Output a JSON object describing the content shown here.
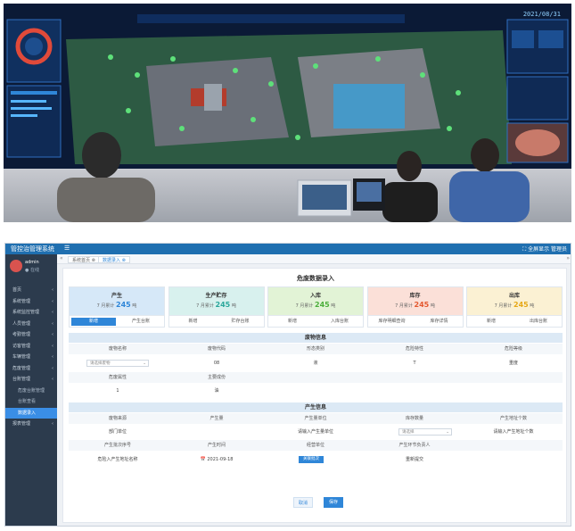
{
  "photo": {
    "wall_title": "",
    "wall_time": "2021/08/31",
    "accent": "#0b1a36"
  },
  "app": {
    "topbar": {
      "system_title": "管控治管理系统",
      "menu_icon": "hamburger-icon",
      "user_menu": "⛶ 全屏显示   管理员"
    },
    "sidebar": {
      "user_name": "admin",
      "user_status": "● 在线",
      "items": [
        {
          "label": "首页",
          "sub": false,
          "active": false
        },
        {
          "label": "系统管理",
          "sub": false,
          "active": false
        },
        {
          "label": "系统监控管理",
          "sub": false,
          "active": false
        },
        {
          "label": "人员管理",
          "sub": false,
          "active": false
        },
        {
          "label": "考勤管理",
          "sub": false,
          "active": false
        },
        {
          "label": "访客管理",
          "sub": false,
          "active": false
        },
        {
          "label": "车辆管理",
          "sub": false,
          "active": false
        },
        {
          "label": "危废管理",
          "sub": false,
          "active": false
        },
        {
          "label": "台账管理",
          "sub": false,
          "active": false
        },
        {
          "label": "危废台账管理",
          "sub": true,
          "active": false
        },
        {
          "label": "台账查看",
          "sub": true,
          "active": false
        },
        {
          "label": "数据录入",
          "sub": true,
          "active": true
        },
        {
          "label": "报表管理",
          "sub": false,
          "active": false
        }
      ]
    },
    "tabs": {
      "items": [
        "系统首页 ⊗",
        "数据录入 ⊗"
      ],
      "left_ctrl": "«",
      "right_ctrl": "»"
    },
    "page_title": "危废数据录入",
    "stat_cards": [
      {
        "label": "产生",
        "sub_prefix": "7 月累计",
        "value": "245",
        "unit": "吨",
        "bg": "#d6e8f8",
        "num_color": "#2f86d8",
        "btn1": "新增",
        "btn2": "产生台账",
        "primary": 1
      },
      {
        "label": "生产贮存",
        "sub_prefix": "7 月累计",
        "value": "245",
        "unit": "吨",
        "bg": "#d8f1ee",
        "num_color": "#2aa79b",
        "btn1": "新增",
        "btn2": "贮存台账",
        "primary": 0
      },
      {
        "label": "入库",
        "sub_prefix": "7 月累计",
        "value": "245",
        "unit": "吨",
        "bg": "#e2f3d6",
        "num_color": "#4caf3c",
        "btn1": "新增",
        "btn2": "入库台账",
        "primary": 0
      },
      {
        "label": "库存",
        "sub_prefix": "7 月累计",
        "value": "245",
        "unit": "吨",
        "bg": "#fbe0d8",
        "num_color": "#e4572e",
        "btn1": "库存明细查询",
        "btn2": "库存详情",
        "primary": 0
      },
      {
        "label": "出库",
        "sub_prefix": "7 月累计",
        "value": "245",
        "unit": "吨",
        "bg": "#fbf1d3",
        "num_color": "#e6a817",
        "btn1": "新增",
        "btn2": "出库台账",
        "primary": 0
      }
    ],
    "waste_info": {
      "title": "废物信息",
      "headers": [
        "废物名称",
        "废物代码",
        "形态类别",
        "危险特性",
        "危险等级"
      ],
      "row1": {
        "select_placeholder": "请选择废物",
        "code": "08",
        "category": "液",
        "hazard": "T",
        "level": "重度"
      },
      "headers2": [
        "危废属性",
        "主要成份"
      ],
      "row2": [
        "1",
        "油"
      ]
    },
    "produce_info": {
      "title": "产生信息",
      "headers": [
        "废物来源",
        "产生量",
        "产生量单位",
        "库存数量",
        "产生地址个数"
      ],
      "row1": {
        "label_a": "部门单位",
        "field_b": "请输入产生量单位",
        "select_c": "请选择",
        "field_d": "请输入产生地址个数"
      },
      "row2_labels": [
        "产生批次序号",
        "产生时间",
        "经营单位",
        "产生环节负责人"
      ],
      "row3": {
        "label": "危险入产生地址名称",
        "date": "📅 2021-09-18",
        "btn": "关联批次",
        "extra": "重新提交"
      }
    },
    "actions": {
      "cancel": "取消",
      "save": "保存"
    }
  }
}
